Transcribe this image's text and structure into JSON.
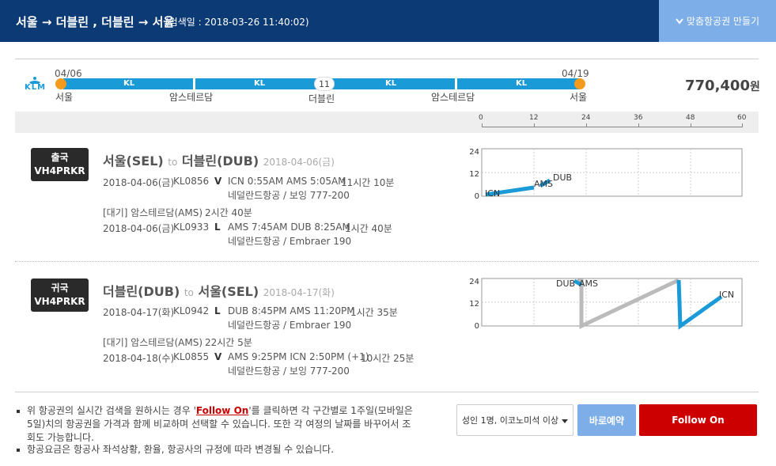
{
  "header": {
    "route": "서울 → 더블린 , 더블린 → 서울",
    "search_date": "(검색일 : 2018-03-26 11:40:02)",
    "custom_button": "맞춤항공권 만들기"
  },
  "itinerary": {
    "airline_logo": "KLM",
    "start_date": "04/06",
    "end_date": "04/19",
    "stay_days": "11",
    "segments": [
      "KL",
      "KL",
      "KL",
      "KL"
    ],
    "stops": [
      "서울",
      "암스테르담",
      "더블린",
      "암스테르담",
      "서울"
    ],
    "price": "770,400",
    "price_unit": "원"
  },
  "timescale": {
    "ticks": [
      "0",
      "12",
      "24",
      "36",
      "48",
      "60"
    ]
  },
  "outbound": {
    "badge_type": "출국",
    "badge_code": "VH4PRKR",
    "title_from": "서울(SEL)",
    "title_to_word": "to",
    "title_to": "더블린(DUB)",
    "title_date": "2018-04-06(금)",
    "flights": [
      {
        "date": "2018-04-06(금)",
        "flight": "KL0856",
        "class": "V",
        "route": "ICN 0:55AM AMS 5:05AM",
        "duration": "11시간 10분",
        "aircraft": "네덜란드항공 / 보잉 777-200"
      },
      {
        "date": "2018-04-06(금)",
        "flight": "KL0933",
        "class": "L",
        "route": "AMS 7:45AM DUB 8:25AM",
        "duration": "1시간 40분",
        "aircraft": "네덜란드항공 / Embraer 190"
      }
    ],
    "layover": "[대기] 암스테르담(AMS)",
    "layover_time": "2시간 40분",
    "chart": {
      "yticks": [
        "24",
        "12",
        "0"
      ],
      "labels": [
        "ICN",
        "AMS",
        "DUB"
      ]
    }
  },
  "inbound": {
    "badge_type": "귀국",
    "badge_code": "VH4PRKR",
    "title_from": "더블린(DUB)",
    "title_to_word": "to",
    "title_to": "서울(SEL)",
    "title_date": "2018-04-17(화)",
    "flights": [
      {
        "date": "2018-04-17(화)",
        "flight": "KL0942",
        "class": "L",
        "route": "DUB 8:45PM AMS 11:20PM",
        "duration": "1시간 35분",
        "aircraft": "네덜란드항공 / Embraer 190"
      },
      {
        "date": "2018-04-18(수)",
        "flight": "KL0855",
        "class": "V",
        "route": "AMS 9:25PM ICN 2:50PM (+1)",
        "duration": "10시간 25분",
        "aircraft": "네덜란드항공 / 보잉 777-200"
      }
    ],
    "layover": "[대기] 암스테르담(AMS)",
    "layover_time": "22시간 5분",
    "chart": {
      "yticks": [
        "24",
        "12",
        "0"
      ],
      "labels": [
        "DUB",
        "AMS",
        "ICN"
      ]
    }
  },
  "notes": {
    "line1_pre": "위 항공권의 실시간 검색을 원하시는 경우 '",
    "line1_link": "Follow On",
    "line1_post": "'를 클릭하면 각 구간별로 1주일(모바일은",
    "line2": "5일)치의 항공권을 가격과 함께 비교하며 선택할 수 있습니다. 또한 각 여정의 날짜를 바꾸어서 조",
    "line3": "회도 가능합니다.",
    "line4": "항공요금은 항공사 좌석상황, 환율, 항공사의 규정에 따라 변경될 수 있습니다."
  },
  "actions": {
    "passenger_select": "성인 1명, 이코노미석 이상",
    "book_button": "바로예약",
    "follow_button": "Follow On"
  },
  "colors": {
    "header_bg": "#0b3a74",
    "accent_blue": "#1a9ad6",
    "follow_red": "#cc0000",
    "light_blue": "#7daee8"
  }
}
